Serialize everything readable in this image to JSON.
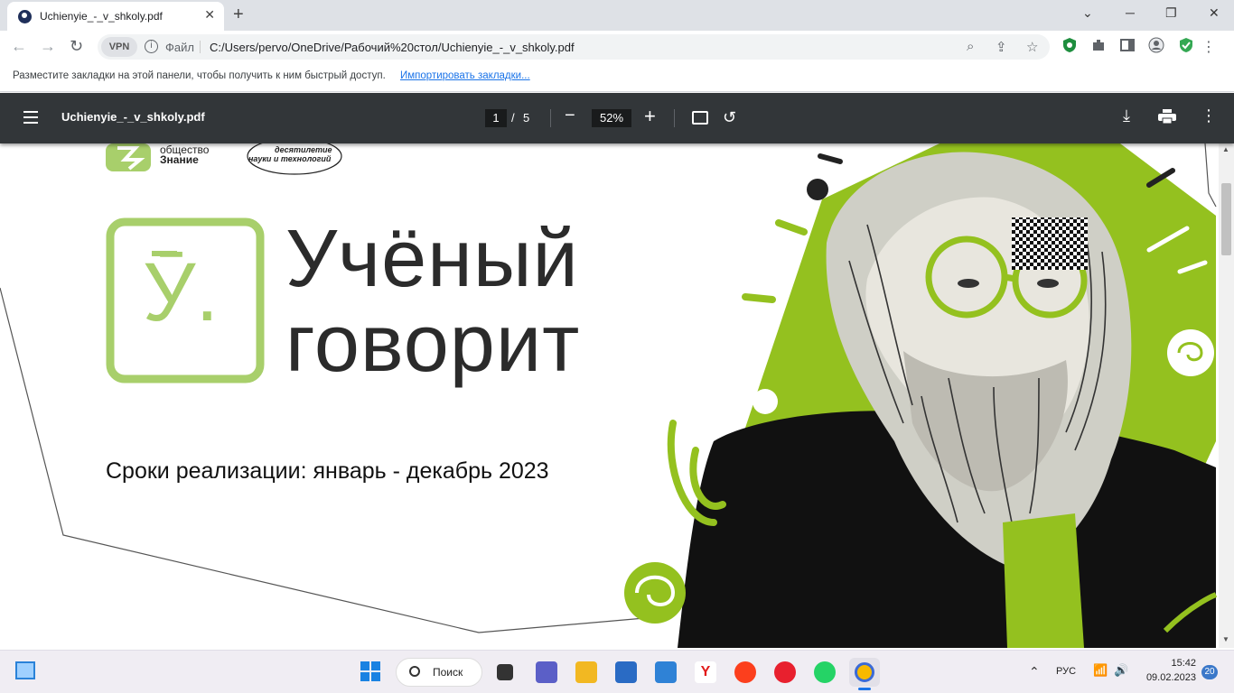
{
  "browser": {
    "tab_title": "Uchienyie_-_v_shkoly.pdf",
    "tab_close": "✕",
    "new_tab": "+",
    "vpn_label": "VPN",
    "file_label": "Файл",
    "url": "C:/Users/pervo/OneDrive/Рабочий%20стол/Uchienyie_-_v_shkoly.pdf",
    "bookmarks_prompt": "Разместите закладки на этой панели, чтобы получить к ним быстрый доступ.",
    "bookmarks_import": "Импортировать закладки..."
  },
  "pdf_viewer": {
    "title": "Uchienyie_-_v_shkoly.pdf",
    "current_page": "1",
    "page_sep": "/",
    "total_pages": "5",
    "zoom": "52%"
  },
  "document": {
    "org1_line1": "общество",
    "org1_line2": "Знание",
    "org2_line1": "десятилетие",
    "org2_line2": "науки и технологий",
    "logo_letter": "Ӯ.",
    "headline_line1": "Учёный",
    "headline_line2": "говорит",
    "period": "Сроки реализации: январь - декабрь 2023"
  },
  "taskbar": {
    "search_label": "Поиск",
    "language": "РУС",
    "time": "15:42",
    "date": "09.02.2023",
    "notifications": "20"
  },
  "colors": {
    "accent_green": "#94c11f",
    "logo_green": "#a8cf6b",
    "headline": "#2b2b2b",
    "pdf_toolbar": "#323639"
  }
}
